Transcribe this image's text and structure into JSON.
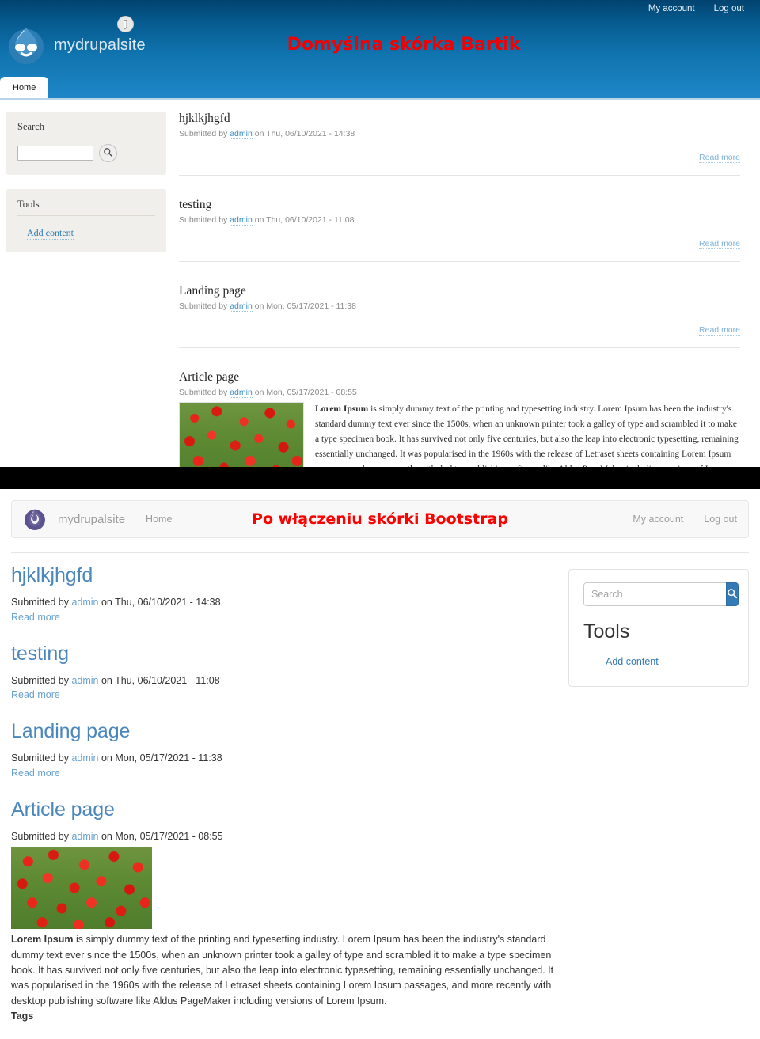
{
  "colors": {
    "bartik_header_top": "#01436f",
    "bartik_header_bottom": "#1f87c7",
    "caption_red": "#f40000",
    "bootstrap_primary": "#337ab7",
    "bootstrap_heading": "#4a87bd",
    "bartik_sidebar_bg": "#f0efeb"
  },
  "bartik": {
    "caption": "Domyślna skórka Bartik",
    "site_name": "mydrupalsite",
    "logo_icon": "drupal-droplet-icon",
    "edit_badge_icon": "pencil-icon",
    "topnav": [
      {
        "label": "My account"
      },
      {
        "label": "Log out"
      }
    ],
    "tabs": [
      {
        "label": "Home",
        "active": true
      }
    ],
    "sidebar": {
      "search_block": {
        "title": "Search",
        "input_value": "",
        "input_placeholder": "",
        "button_icon": "search-icon"
      },
      "tools_block": {
        "title": "Tools",
        "links": [
          {
            "label": "Add content"
          }
        ]
      }
    },
    "articles": [
      {
        "title": "hjklkjhgfd",
        "submitted_prefix": "Submitted by",
        "author": "admin",
        "submitted_suffix": "on Thu, 06/10/2021 - 14:38",
        "read_more": "Read more"
      },
      {
        "title": "testing",
        "submitted_prefix": "Submitted by",
        "author": "admin",
        "submitted_suffix": "on Thu, 06/10/2021 - 11:08",
        "read_more": "Read more"
      },
      {
        "title": "Landing page",
        "submitted_prefix": "Submitted by",
        "author": "admin",
        "submitted_suffix": "on Mon, 05/17/2021 - 11:38",
        "read_more": "Read more"
      },
      {
        "title": "Article page",
        "submitted_prefix": "Submitted by",
        "author": "admin",
        "submitted_suffix": "on Mon, 05/17/2021 - 08:55",
        "image_alt": "field of red poppies",
        "body_lead": "Lorem Ipsum",
        "body_text": " is simply dummy text of the printing and typesetting industry. Lorem Ipsum has been the industry's standard dummy text ever since the 1500s, when an unknown printer took a galley of type and scrambled it to make a type specimen book. It has survived not only five centuries, but also the leap into electronic typesetting, remaining essentially unchanged. It was popularised in the 1960s with the release of Letraset sheets containing Lorem Ipsum passages, and more recently with desktop publishing software like Aldus PageMaker including versions of Lorem Ipsum."
      }
    ]
  },
  "bootstrap": {
    "caption": "Po włączeniu skórki Bootstrap",
    "site_name": "mydrupalsite",
    "logo_icon": "drupal-droplet-icon",
    "navlinks": [
      {
        "label": "Home"
      }
    ],
    "topnav": [
      {
        "label": "My account"
      },
      {
        "label": "Log out"
      }
    ],
    "sidebar": {
      "search_block": {
        "input_value": "",
        "input_placeholder": "Search",
        "button_icon": "search-icon"
      },
      "tools_block": {
        "title": "Tools",
        "links": [
          {
            "label": "Add content"
          }
        ]
      }
    },
    "articles": [
      {
        "title": "hjklkjhgfd",
        "submitted_prefix": "Submitted by",
        "author": "admin",
        "submitted_suffix": "on Thu, 06/10/2021 - 14:38",
        "read_more": "Read more"
      },
      {
        "title": "testing",
        "submitted_prefix": "Submitted by",
        "author": "admin",
        "submitted_suffix": "on Thu, 06/10/2021 - 11:08",
        "read_more": "Read more"
      },
      {
        "title": "Landing page",
        "submitted_prefix": "Submitted by",
        "author": "admin",
        "submitted_suffix": "on Mon, 05/17/2021 - 11:38",
        "read_more": "Read more"
      },
      {
        "title": "Article page",
        "submitted_prefix": "Submitted by",
        "author": "admin",
        "submitted_suffix": "on Mon, 05/17/2021 - 08:55",
        "image_alt": "field of red poppies",
        "body_lead": "Lorem Ipsum",
        "body_text": " is simply dummy text of the printing and typesetting industry. Lorem Ipsum has been the industry's standard dummy text ever since the 1500s, when an unknown printer took a galley of type and scrambled it to make a type specimen book. It has survived not only five centuries, but also the leap into electronic typesetting, remaining essentially unchanged. It was popularised in the 1960s with the release of Letraset sheets containing Lorem Ipsum passages, and more recently with desktop publishing software like Aldus PageMaker including versions of Lorem Ipsum.",
        "tags_label": "Tags"
      }
    ]
  }
}
